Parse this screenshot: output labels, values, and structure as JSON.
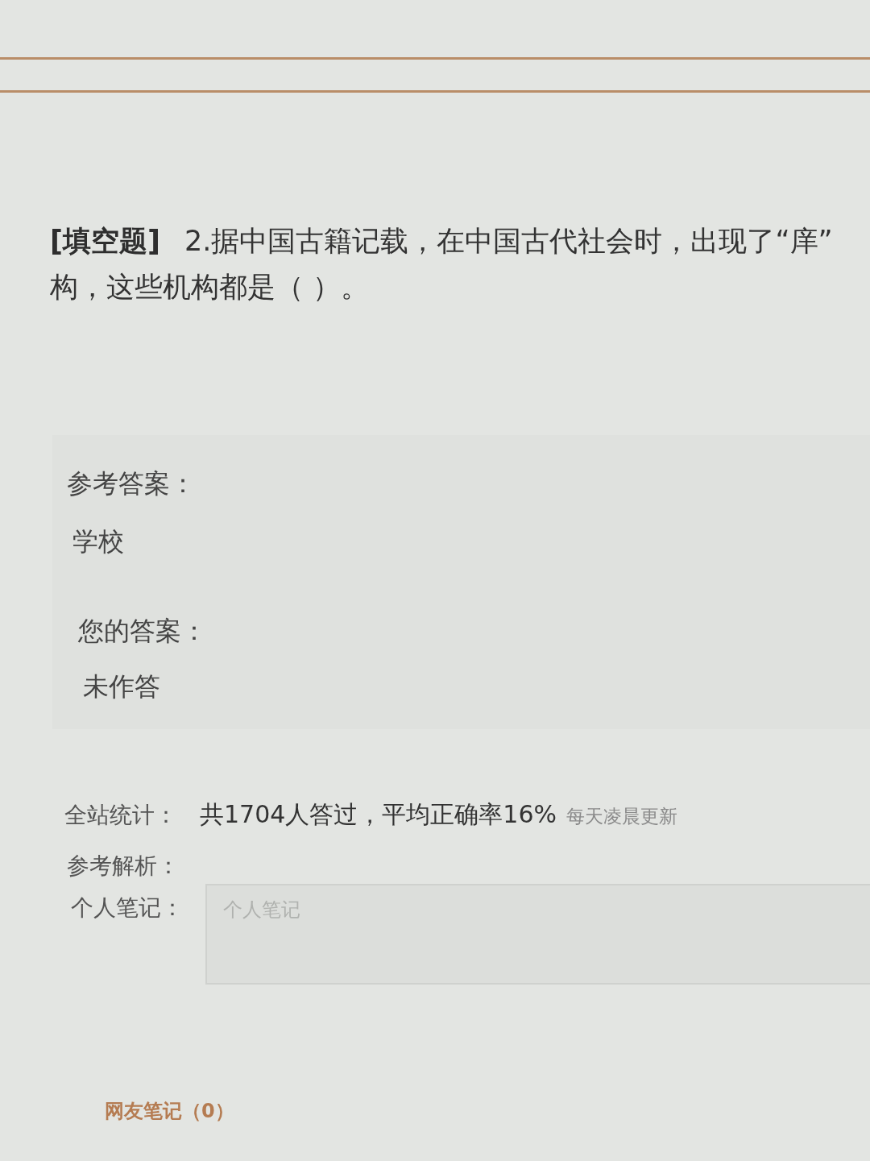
{
  "question": {
    "type_tag": "[填空题]",
    "lines": [
      "2.据中国古籍记载，在中国古代社会时，出现了“庠”",
      "构，这些机构都是（  ）。"
    ]
  },
  "answer_panel": {
    "reference_label": "参考答案：",
    "reference_answer": "学校",
    "your_label": "您的答案：",
    "your_answer": "未作答"
  },
  "stats": {
    "label": "全站统计：",
    "summary": "共1704人答过，平均正确率16%",
    "note": "每天凌晨更新"
  },
  "analysis": {
    "label": "参考解析："
  },
  "notes": {
    "label": "个人笔记：",
    "placeholder": "个人笔记"
  },
  "community_notes": {
    "label": "网友笔记（0）"
  }
}
